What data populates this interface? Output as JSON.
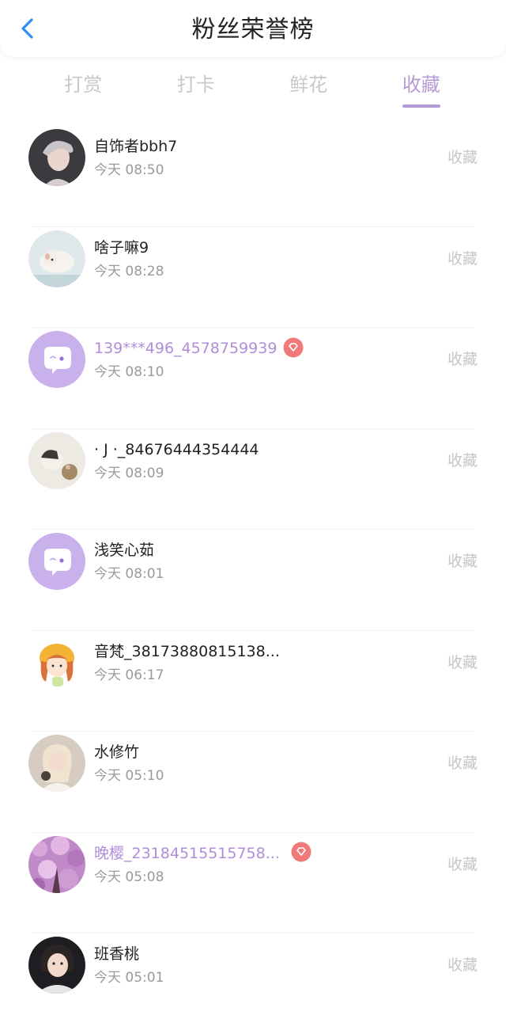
{
  "header": {
    "title": "粉丝荣誉榜",
    "back_icon": "chevron-left-icon",
    "accent": "#2f8df6"
  },
  "tabs": [
    {
      "label": "打赏",
      "active": false
    },
    {
      "label": "打卡",
      "active": false
    },
    {
      "label": "鲜花",
      "active": false
    },
    {
      "label": "收藏",
      "active": true
    }
  ],
  "colors": {
    "active_tab": "#b69ad6",
    "vip_name": "#b08dd9",
    "badge": "#f07a7a"
  },
  "list": [
    {
      "name": "自饰者bbh7",
      "time": "今天 08:50",
      "action": "收藏",
      "vip": false,
      "avatar": "photo-avatar"
    },
    {
      "name": "啥子嘛9",
      "time": "今天 08:28",
      "action": "收藏",
      "vip": false,
      "avatar": "photo-avatar"
    },
    {
      "name": "139***496_4578759939",
      "time": "今天 08:10",
      "action": "收藏",
      "vip": true,
      "avatar": "default-chat-avatar"
    },
    {
      "name": "· J ·_84676444354444",
      "time": "今天 08:09",
      "action": "收藏",
      "vip": false,
      "avatar": "photo-avatar"
    },
    {
      "name": "浅笑心茹",
      "time": "今天 08:01",
      "action": "收藏",
      "vip": false,
      "avatar": "default-chat-avatar"
    },
    {
      "name": "音梵_38173880815138...",
      "time": "今天 06:17",
      "action": "收藏",
      "vip": false,
      "avatar": "cartoon-avatar"
    },
    {
      "name": "水修竹",
      "time": "今天 05:10",
      "action": "收藏",
      "vip": false,
      "avatar": "photo-avatar"
    },
    {
      "name": "晚樱_23184515515758...",
      "time": "今天 05:08",
      "action": "收藏",
      "vip": true,
      "avatar": "flower-avatar"
    },
    {
      "name": "班香桃",
      "time": "今天 05:01",
      "action": "收藏",
      "vip": false,
      "avatar": "photo-avatar"
    }
  ]
}
